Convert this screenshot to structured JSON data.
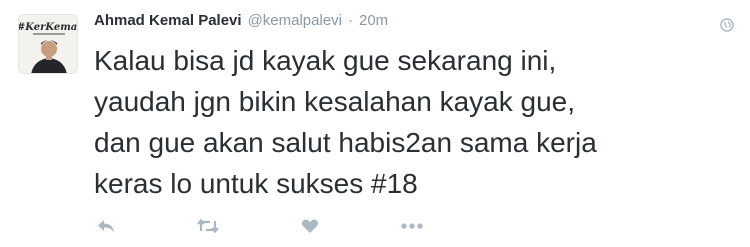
{
  "tweet": {
    "author_name": "Ahmad Kemal Palevi",
    "handle": "@kemalpalevi",
    "separator": "·",
    "time": "20m",
    "text": "Kalau bisa jd kayak gue sekarang ini,\nyaudah jgn bikin kesalahan kayak gue,\ndan gue akan salut habis2an sama kerja\nkeras lo untuk sukses #18"
  },
  "icons": {
    "visibility": "globe-icon",
    "reply": "reply-icon",
    "retweet": "retweet-icon",
    "like": "heart-icon",
    "more": "more-icon"
  },
  "avatar_lettering": "#KerKemal",
  "colors": {
    "text": "#292f33",
    "secondary": "#8899a6",
    "icon": "#aab8c2"
  }
}
